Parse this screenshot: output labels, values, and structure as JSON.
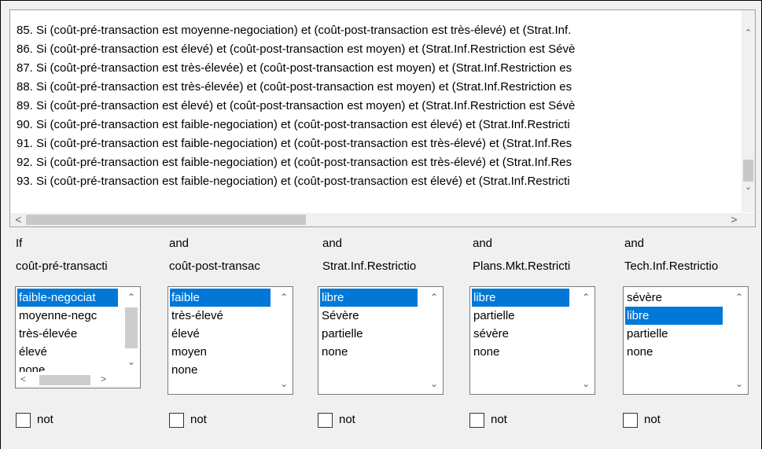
{
  "rules": {
    "lines": [
      "85. Si (coût-pré-transaction est moyenne-negociation) et (coût-post-transaction est très-élevé) et (Strat.Inf.",
      "86. Si (coût-pré-transaction est élevé) et (coût-post-transaction est moyen) et (Strat.Inf.Restriction est Sévè",
      "87. Si (coût-pré-transaction est très-élevée) et (coût-post-transaction est moyen) et (Strat.Inf.Restriction es",
      "88. Si (coût-pré-transaction est très-élevée) et (coût-post-transaction est moyen) et (Strat.Inf.Restriction es",
      "89. Si (coût-pré-transaction est élevé) et (coût-post-transaction est moyen) et (Strat.Inf.Restriction est Sévè",
      "90. Si (coût-pré-transaction est faible-negociation) et (coût-post-transaction est élevé) et (Strat.Inf.Restricti",
      "91. Si (coût-pré-transaction est faible-negociation) et (coût-post-transaction est très-élevé) et (Strat.Inf.Res",
      "92. Si (coût-pré-transaction est faible-negociation) et (coût-post-transaction est très-élevé) et (Strat.Inf.Res",
      "93. Si (coût-pré-transaction est faible-negociation) et (coût-post-transaction est élevé) et (Strat.Inf.Restricti"
    ]
  },
  "columns": [
    {
      "keyword": "If",
      "variable": "coût-pré-transacti",
      "options": [
        "faible-negociat",
        "moyenne-negc",
        "très-élevée",
        "élevé",
        "none"
      ],
      "selected_index": 0,
      "not_label": "not"
    },
    {
      "keyword": "and",
      "variable": "coût-post-transac",
      "options": [
        "faible",
        "très-élevé",
        "élevé",
        "moyen",
        "none"
      ],
      "selected_index": 0,
      "not_label": "not"
    },
    {
      "keyword": "and",
      "variable": "Strat.Inf.Restrictio",
      "options": [
        "libre",
        "Sévère",
        "partielle",
        "none"
      ],
      "selected_index": 0,
      "not_label": "not"
    },
    {
      "keyword": "and",
      "variable": "Plans.Mkt.Restricti",
      "options": [
        "libre",
        "partielle",
        "sévère",
        "none"
      ],
      "selected_index": 0,
      "not_label": "not"
    },
    {
      "keyword": "and",
      "variable": "Tech.Inf.Restrictio",
      "options": [
        "sévère",
        "libre",
        "partielle",
        "none"
      ],
      "selected_index": 1,
      "not_label": "not"
    }
  ],
  "colors": {
    "selection": "#0078d7",
    "background": "#f0f0f0"
  }
}
